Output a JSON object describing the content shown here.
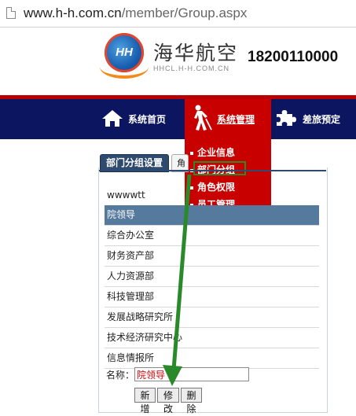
{
  "browser": {
    "url_host": "www.h-h.com.cn",
    "url_path": "/member/Group.aspx"
  },
  "header": {
    "logo_text": "HH",
    "brand_cn": "海华航空",
    "brand_en": "HHCL.H-H.COM.CN",
    "phone": "18200110000"
  },
  "nav": {
    "home": "系统首页",
    "system": "系统管理",
    "travel": "差旅预定"
  },
  "dropdown": {
    "items": [
      "企业信息",
      "部门分组",
      "角色权限",
      "员工管理"
    ],
    "highlighted": "部门分组"
  },
  "tabs": {
    "active": "部门分组设置",
    "second": "",
    "second_partial": "角"
  },
  "group_list": {
    "company": "wwwwtt",
    "rows": [
      "院领导",
      "综合办公室",
      "财务资产部",
      "人力资源部",
      "科技管理部",
      "发展战略研究所",
      "技术经济研究中心",
      "信息情报所"
    ],
    "selected": "院领导"
  },
  "form": {
    "name_label": "名称：",
    "name_value": "院领导",
    "add_button": "新增",
    "edit_button": "修改",
    "delete_button": "删除"
  },
  "colors": {
    "nav_bg": "#0c1660",
    "accent_red": "#c80000",
    "selected_row": "#56799e",
    "annotation_green": "#2a8a2a"
  }
}
